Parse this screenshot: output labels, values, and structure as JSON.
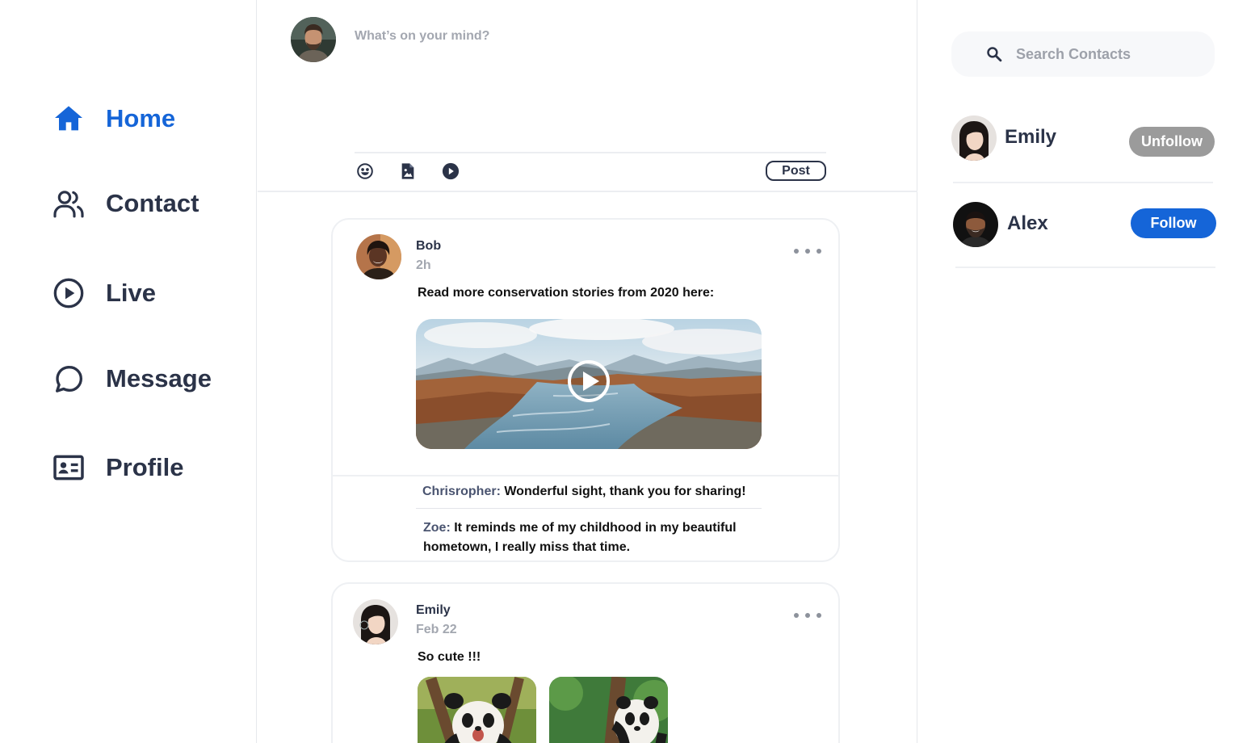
{
  "colors": {
    "accent": "#1565d8",
    "text": "#2b3348",
    "muted": "#a3a7b0",
    "unfollow": "#9b9b9b"
  },
  "sidebar": {
    "items": [
      {
        "label": "Home",
        "icon": "home-icon",
        "active": true
      },
      {
        "label": "Contact",
        "icon": "users-icon",
        "active": false
      },
      {
        "label": "Live",
        "icon": "play-circle-icon",
        "active": false
      },
      {
        "label": "Message",
        "icon": "chat-bubble-icon",
        "active": false
      },
      {
        "label": "Profile",
        "icon": "id-card-icon",
        "active": false
      }
    ]
  },
  "composer": {
    "placeholder": "What’s on your mind?",
    "tools": [
      "emoji-icon",
      "image-file-icon",
      "play-icon"
    ],
    "post_label": "Post"
  },
  "feed": {
    "posts": [
      {
        "author": "Bob",
        "time": "2h",
        "text": "Read more conservation stories from 2020 here:",
        "media": "video",
        "comments": [
          {
            "author": "Chrisropher:",
            "text": " Wonderful sight, thank you for sharing!"
          },
          {
            "author": "Zoe:",
            "text": " It reminds me of my childhood in my beautiful hometown, I really miss that time."
          }
        ]
      },
      {
        "author": "Emily",
        "time": "Feb 22",
        "text": "So cute !!!",
        "media": "photos"
      }
    ]
  },
  "search": {
    "placeholder": "Search Contacts"
  },
  "contacts": [
    {
      "name": "Emily",
      "action": "Unfollow"
    },
    {
      "name": "Alex",
      "action": "Follow"
    }
  ]
}
